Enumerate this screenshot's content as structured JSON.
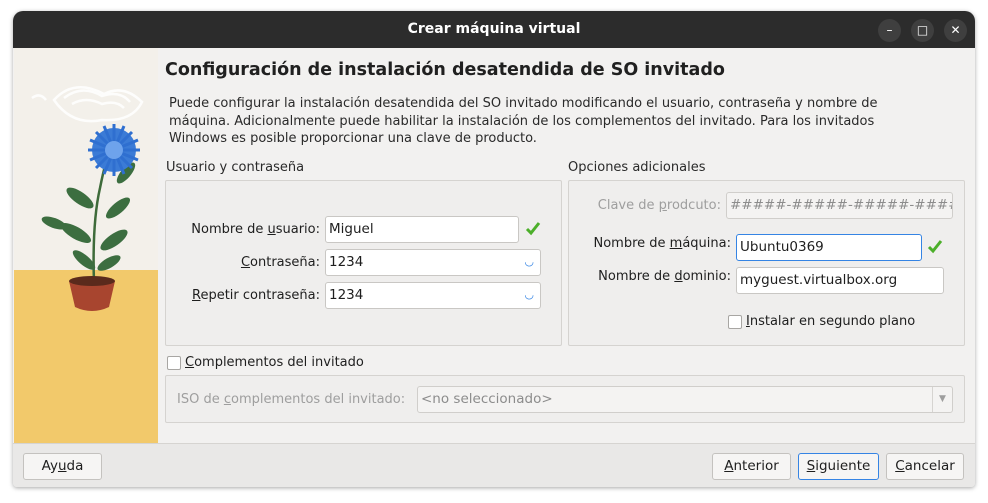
{
  "window": {
    "title": "Crear máquina virtual",
    "controls": {
      "minimize": "–",
      "maximize": "□",
      "close": "✕"
    }
  },
  "page": {
    "heading": "Configuración de instalación desatendida de SO invitado",
    "description": "Puede configurar la instalación desatendida del SO invitado modificando el usuario, contraseña y nombre de máquina. Adicionalmente puede habilitar la instalación de los complementos del invitado. Para los invitados Windows es posible proporcionar una clave de producto."
  },
  "user_group": {
    "title": "Usuario y contraseña",
    "username": {
      "label_pre": "Nombre de ",
      "label_ul": "u",
      "label_post": "suario:",
      "value": "Miguel"
    },
    "password": {
      "label_pre": "",
      "label_ul": "C",
      "label_post": "ontraseña:",
      "value": "1234"
    },
    "repeat": {
      "label_pre": "",
      "label_ul": "R",
      "label_post": "epetir contraseña:",
      "value": "1234"
    }
  },
  "options_group": {
    "title": "Opciones adicionales",
    "product_key": {
      "label_pre": "Clave de ",
      "label_ul": "p",
      "label_post": "rodcuto:",
      "value": "#####-#####-#####-#####-#"
    },
    "hostname": {
      "label_pre": "Nombre de ",
      "label_ul": "m",
      "label_post": "áquina:",
      "value": "Ubuntu0369"
    },
    "domain": {
      "label_pre": "Nombre de ",
      "label_ul": "d",
      "label_post": "ominio:",
      "value": "myguest.virtualbox.org"
    },
    "background_install": {
      "label_pre": "",
      "label_ul": "I",
      "label_post": "nstalar en segundo plano"
    }
  },
  "guest_additions": {
    "label_pre": "",
    "label_ul": "C",
    "label_post": "omplementos del invitado",
    "iso": {
      "label_pre": "ISO de ",
      "label_ul": "c",
      "label_post": "omplementos del invitado:",
      "value": "<no seleccionado>"
    }
  },
  "footer": {
    "help": {
      "pre": "Ay",
      "ul": "u",
      "post": "da"
    },
    "back": {
      "pre": "",
      "ul": "A",
      "post": "nterior"
    },
    "next": {
      "pre": "",
      "ul": "S",
      "post": "iguiente"
    },
    "cancel": {
      "pre": "",
      "ul": "C",
      "post": "ancelar"
    }
  },
  "colors": {
    "accent": "#3584e4",
    "check_green": "#4caf2a",
    "titlebar": "#2c2c2c"
  }
}
